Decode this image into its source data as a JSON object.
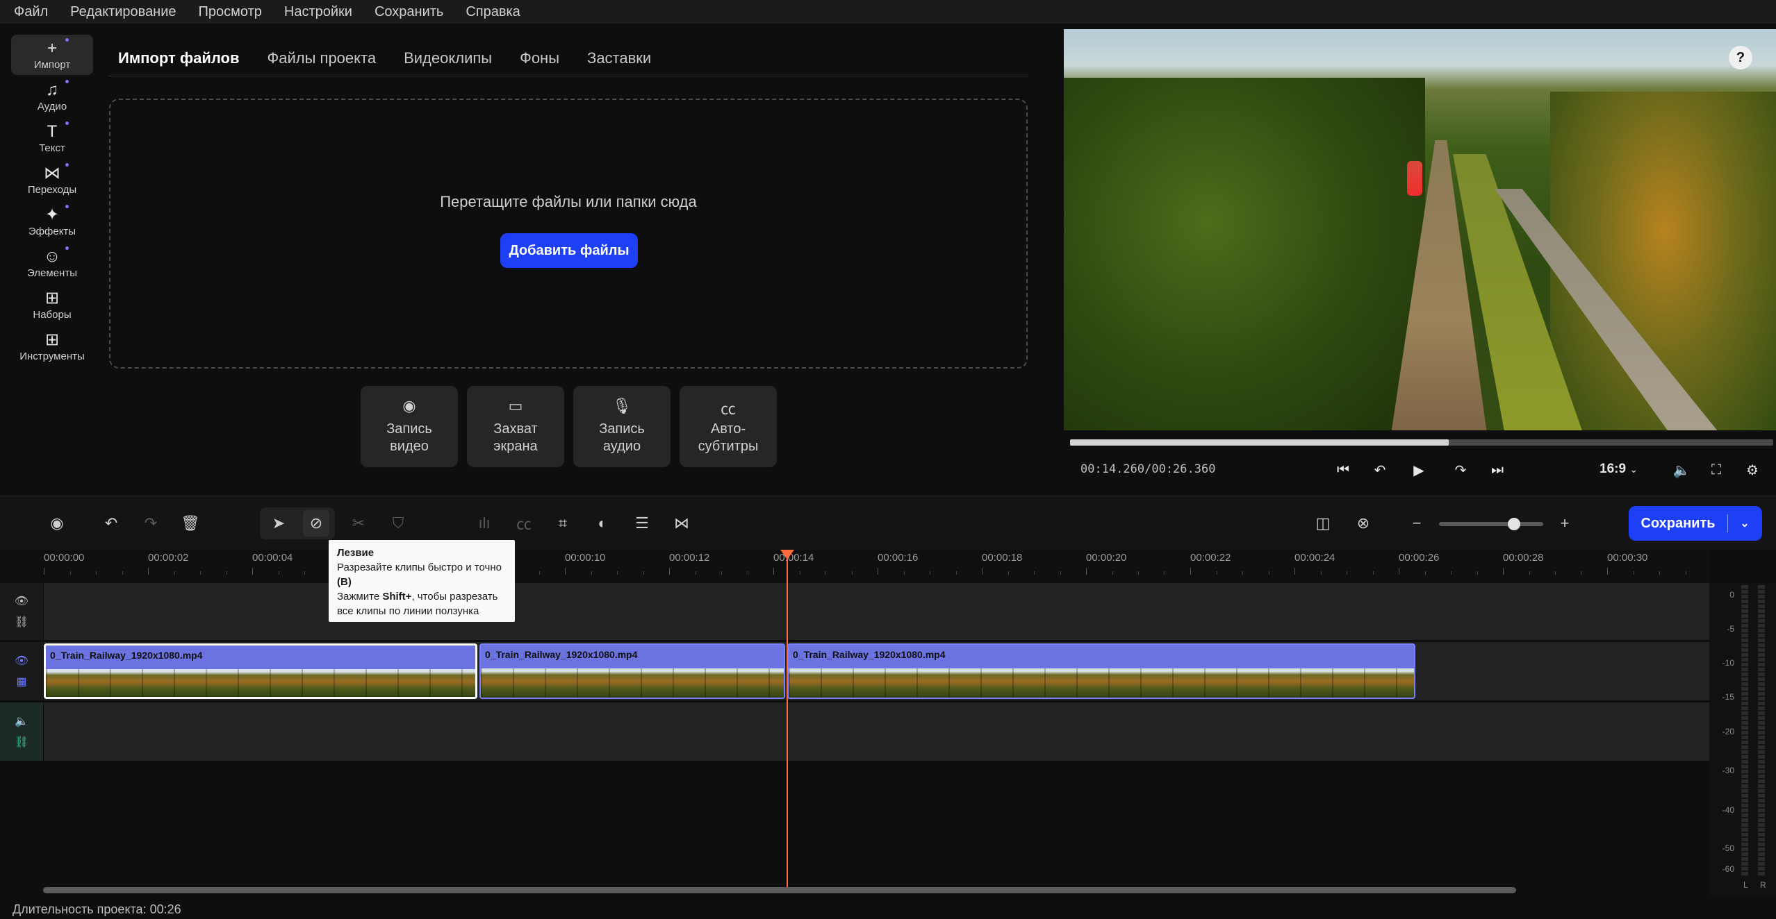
{
  "menu": [
    "Файл",
    "Редактирование",
    "Просмотр",
    "Настройки",
    "Сохранить",
    "Справка"
  ],
  "sidebar": {
    "items": [
      {
        "label": "Импорт",
        "icon": "plus-icon",
        "glyph": "+"
      },
      {
        "label": "Аудио",
        "icon": "music-note-icon",
        "glyph": "♫"
      },
      {
        "label": "Текст",
        "icon": "text-icon",
        "glyph": "T"
      },
      {
        "label": "Переходы",
        "icon": "transition-icon",
        "glyph": "⋈"
      },
      {
        "label": "Эффекты",
        "icon": "sparkle-icon",
        "glyph": "✦"
      },
      {
        "label": "Элементы",
        "icon": "smiley-icon",
        "glyph": "☺"
      },
      {
        "label": "Наборы",
        "icon": "bag-icon",
        "glyph": "⊞"
      },
      {
        "label": "Инструменты",
        "icon": "grid-plus-icon",
        "glyph": "⊞"
      }
    ]
  },
  "media_tabs": [
    "Импорт файлов",
    "Файлы проекта",
    "Видеоклипы",
    "Фоны",
    "Заставки"
  ],
  "dropzone": {
    "text": "Перетащите файлы или папки сюда",
    "button": "Добавить файлы"
  },
  "record_buttons": [
    {
      "label": "Запись\nвидео",
      "icon": "webcam-icon",
      "glyph": "◉"
    },
    {
      "label": "Захват\nэкрана",
      "icon": "monitor-icon",
      "glyph": "▭"
    },
    {
      "label": "Запись\nаудио",
      "icon": "microphone-icon",
      "glyph": "🎙"
    },
    {
      "label": "Авто-\nсубтитры",
      "icon": "cc-icon",
      "glyph": "㏄"
    }
  ],
  "preview": {
    "help": "?",
    "progress_fraction": 0.539,
    "timecode": "00:14.260/00:26.360",
    "aspect": "16:9"
  },
  "toolbar": {
    "save_label": "Сохранить"
  },
  "ruler": {
    "labels": [
      "00:00:00",
      "00:00:02",
      "00:00:04",
      "00:00:06",
      "00:00:08",
      "00:00:10",
      "00:00:12",
      "00:00:14",
      "00:00:16",
      "00:00:18",
      "00:00:20",
      "00:00:22",
      "00:00:24",
      "00:00:26",
      "00:00:28",
      "00:00:30"
    ]
  },
  "tooltip": {
    "title": "Лезвие",
    "line1": "Разрезайте клипы быстро и точно",
    "key": "(B)",
    "line2a": "Зажмите",
    "shift": "Shift+",
    "line2b": ", чтобы разрезать все клипы по линии ползунка"
  },
  "clips": [
    {
      "name": "0_Train_Railway_1920x1080.mp4"
    },
    {
      "name": "0_Train_Railway_1920x1080.mp4"
    },
    {
      "name": "0_Train_Railway_1920x1080.mp4"
    }
  ],
  "meters": {
    "scale": [
      "0",
      "-5",
      "-10",
      "-15",
      "-20",
      "-30",
      "-40",
      "-50",
      "-60"
    ],
    "channels": [
      "L",
      "R"
    ]
  },
  "zoom_level_fraction": 0.72,
  "status": "Длительность проекта: 00:26",
  "colors": {
    "accent": "#1d3ff5",
    "clip": "#6a73e0",
    "playhead": "#ff6a3a",
    "audio_track": "#3ec59e"
  }
}
